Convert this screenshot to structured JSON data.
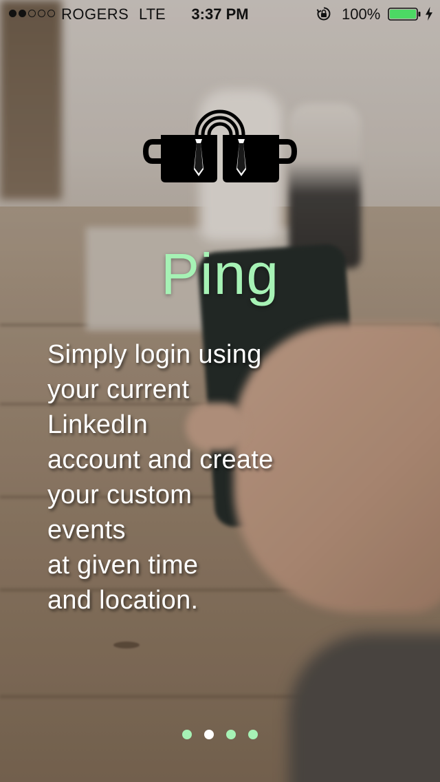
{
  "status_bar": {
    "signal_full": 2,
    "signal_total": 5,
    "carrier": "ROGERS",
    "network": "LTE",
    "time": "3:37 PM",
    "rotation_lock_icon": "rotation-lock-icon",
    "battery_percent": "100%",
    "battery_level": 1.0,
    "battery_color": "#4cd964",
    "charging_icon": "lightning-bolt-icon"
  },
  "onboarding": {
    "logo_icon": "coffee-cups-wifi-icon",
    "title": "Ping",
    "title_color": "#a6f2b5",
    "description_lines": [
      "Simply login using",
      "your current",
      "LinkedIn",
      "account and create",
      "your custom",
      "events",
      "at given time",
      "and location."
    ]
  },
  "pager": {
    "page_count": 4,
    "current_page": 2,
    "dot_color": "#a6f2b5",
    "active_dot_color": "#ffffff"
  }
}
